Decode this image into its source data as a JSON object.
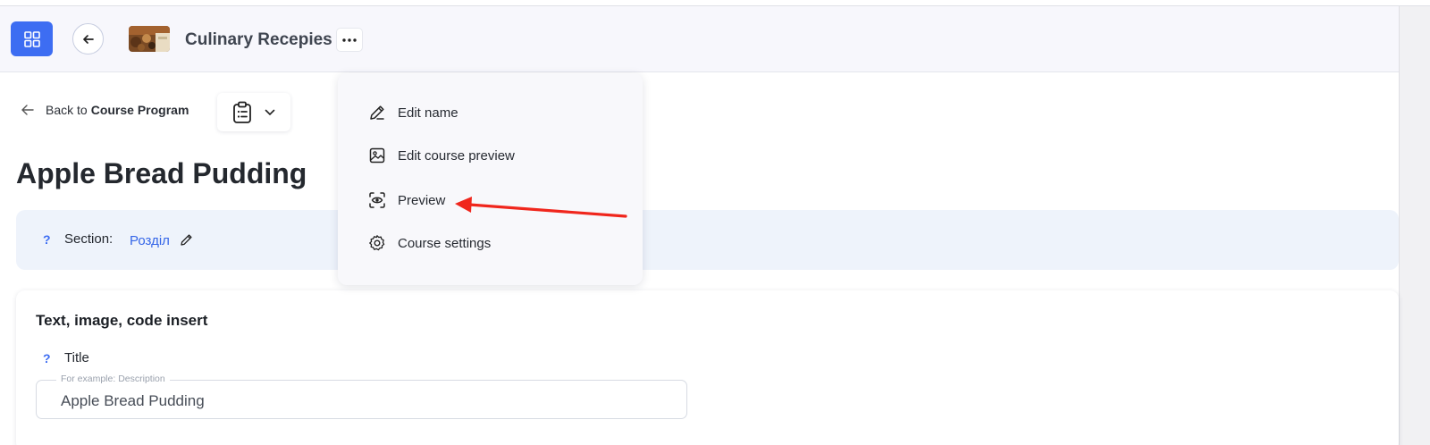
{
  "topbar": {
    "course_title": "Culinary Recepies",
    "apps_icon": "grid-icon",
    "back_icon": "arrow-left-icon",
    "more_icon": "ellipsis-icon"
  },
  "nav": {
    "back_prefix": "Back to",
    "back_target": "Course Program"
  },
  "page": {
    "title": "Apple Bread Pudding"
  },
  "section": {
    "help": "?",
    "label": "Section:",
    "value": "Розділ"
  },
  "card": {
    "title": "Text, image, code insert",
    "field_help": "?",
    "field_label": "Title",
    "input_placeholder": "For example: Description",
    "input_value": "Apple Bread Pudding"
  },
  "menu": {
    "items": [
      {
        "label": "Edit name",
        "icon": "pencil-icon"
      },
      {
        "label": "Edit course preview",
        "icon": "image-icon"
      },
      {
        "label": "Preview",
        "icon": "eye-icon"
      },
      {
        "label": "Course settings",
        "icon": "gear-icon"
      }
    ]
  },
  "colors": {
    "accent": "#3d6df2",
    "annotation_arrow": "#f0261c"
  }
}
